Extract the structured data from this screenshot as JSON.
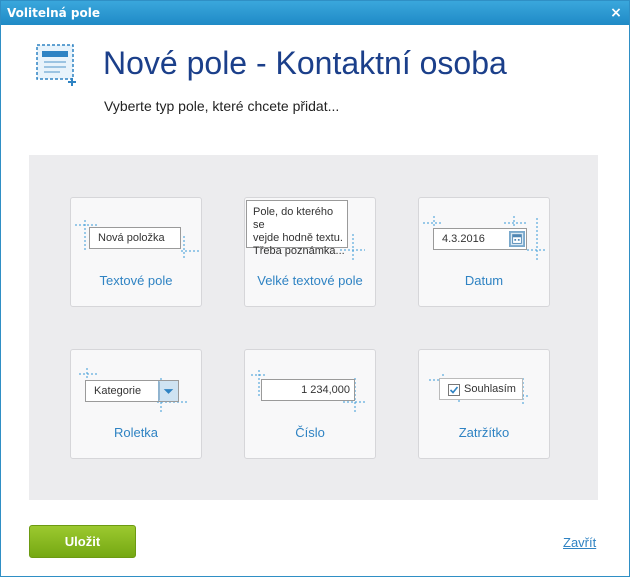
{
  "window": {
    "title": "Volitelná pole",
    "close_glyph": "×"
  },
  "header": {
    "title": "Nové pole - Kontaktní osoba",
    "subtitle": "Vyberte typ pole, které chcete přidat...",
    "icon": "form-field-add-icon"
  },
  "field_types": [
    {
      "label": "Textové pole",
      "sample": "Nová položka"
    },
    {
      "label": "Velké textové pole",
      "sample_lines": [
        "Pole, do kterého se",
        "vejde hodně textu.",
        "Třeba poznámka..."
      ]
    },
    {
      "label": "Datum",
      "sample": "4.3.2016",
      "icon": "calendar-icon"
    },
    {
      "label": "Roletka",
      "sample": "Kategorie",
      "icon": "dropdown-arrow-icon"
    },
    {
      "label": "Číslo",
      "sample": "1 234,000"
    },
    {
      "label": "Zatržítko",
      "sample": "Souhlasím",
      "checked": true
    }
  ],
  "footer": {
    "save_label": "Uložit",
    "close_label": "Zavřít"
  },
  "colors": {
    "accent": "#2f83c3",
    "title_blue": "#1b3f8a",
    "save_green": "#84b81f",
    "titlebar": "#2a97d1"
  }
}
